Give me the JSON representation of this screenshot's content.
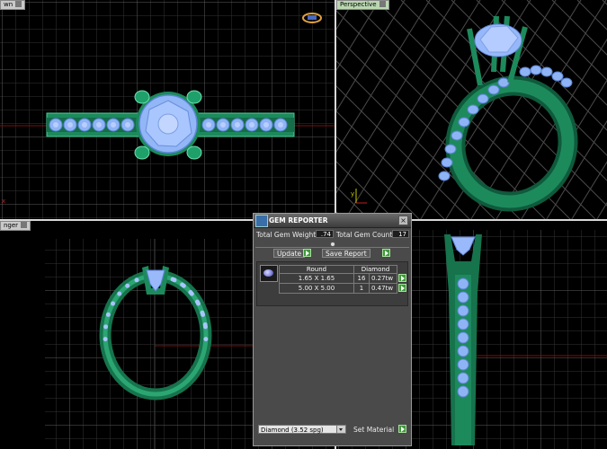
{
  "viewports": {
    "top": {
      "label": "wn"
    },
    "perspective": {
      "label": "Perspective"
    },
    "front": {
      "label": "nger"
    },
    "right": {
      "label": ""
    }
  },
  "colors": {
    "metal": "#1f8c5e",
    "metal_light": "#2db07a",
    "gem": "#8fb4ff",
    "grid": "#3a3a3a",
    "grid_major": "#6a6a6a",
    "axis_red": "#c02020"
  },
  "gem_reporter": {
    "title": "GEM REPORTER",
    "total_weight_label": "Total Gem Weight",
    "total_weight_value": ".74",
    "total_count_label": "Total Gem Count",
    "total_count_value": "17",
    "update_label": "Update",
    "save_report_label": "Save Report",
    "table": {
      "headers": [
        "Round",
        "Diamond"
      ],
      "rows": [
        {
          "size": "1.65 X 1.65",
          "count": "16",
          "weight": "0.27tw"
        },
        {
          "size": "5.00 X 5.00",
          "count": "1",
          "weight": "0.47tw"
        }
      ]
    },
    "material_select": "Diamond    (3.52 spg)",
    "set_material_label": "Set Material"
  }
}
